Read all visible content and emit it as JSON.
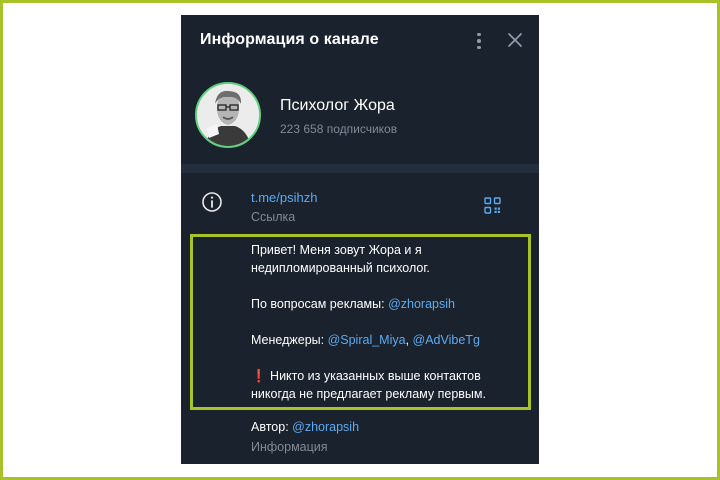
{
  "header": {
    "title": "Информация о канале"
  },
  "channel": {
    "name": "Психолог Жора",
    "subscribers": "223 658 подписчиков"
  },
  "link": {
    "url": "t.me/psihzh",
    "label": "Ссылка"
  },
  "description": {
    "line1": "Привет! Меня зовут Жора и я",
    "line2": "недипломированный психолог.",
    "ads_prefix": "По вопросам рекламы: ",
    "ads_handle": "@zhorapsih",
    "managers_prefix": "Менеджеры: ",
    "manager1": "@Spiral_Miya",
    "managers_sep": ", ",
    "manager2": "@AdVibeTg",
    "warning_mark": "❗",
    "warning_line1": " Никто из указанных выше контактов",
    "warning_line2": "никогда не предлагает рекламу первым."
  },
  "author": {
    "prefix": "Автор: ",
    "handle": "@zhorapsih",
    "label": "Информация"
  },
  "icons": {
    "more": "more-vertical-icon",
    "close": "close-icon",
    "info": "info-icon",
    "qr": "qr-code-icon"
  },
  "colors": {
    "panel_bg": "#19222d",
    "link": "#5eaaf0",
    "secondary_text": "#7f8b96",
    "avatar_ring": "#5fd17d",
    "highlight": "#a8c328"
  }
}
